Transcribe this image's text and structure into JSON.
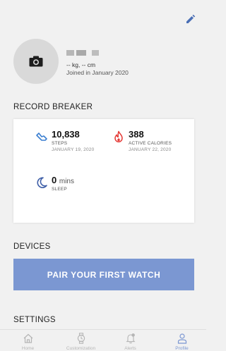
{
  "profile": {
    "weight_height": "-- kg, -- cm",
    "joined": "Joined in January 2020"
  },
  "record_breaker": {
    "title": "RECORD BREAKER",
    "steps": {
      "value": "10,838",
      "label": "STEPS",
      "date": "JANUARY 19, 2020"
    },
    "calories": {
      "value": "388",
      "label": "ACTIVE CALORIES",
      "date": "JANUARY 22, 2020"
    },
    "sleep": {
      "value": "0",
      "unit": "mins",
      "label": "SLEEP"
    }
  },
  "devices": {
    "title": "DEVICES",
    "pair_label": "PAIR YOUR FIRST WATCH"
  },
  "settings": {
    "title": "SETTINGS"
  },
  "tabs": [
    {
      "label": "Home",
      "icon": "home-icon"
    },
    {
      "label": "Customization",
      "icon": "watch-icon"
    },
    {
      "label": "Alerts",
      "icon": "bell-icon"
    },
    {
      "label": "Profile",
      "icon": "profile-icon",
      "active": true
    }
  ],
  "colors": {
    "accent": "#7b97d2",
    "steps_icon": "#3b7fd1",
    "calories_icon": "#e53935",
    "sleep_icon": "#3f5fa8"
  }
}
